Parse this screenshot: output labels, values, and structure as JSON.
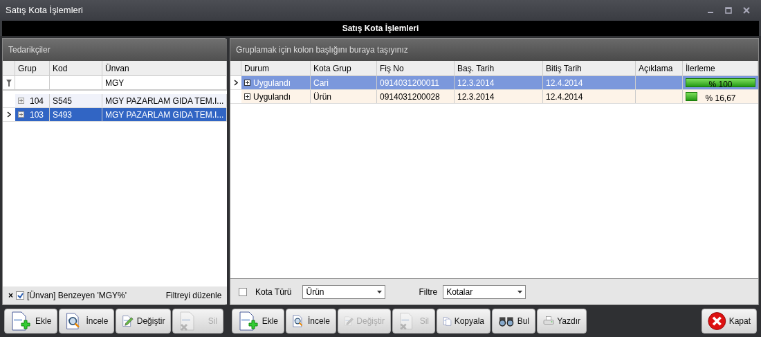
{
  "window": {
    "title": "Satış Kota İşlemleri"
  },
  "header": {
    "title": "Satış Kota İşlemleri"
  },
  "left": {
    "group_title": "Tedarikçiler",
    "columns": [
      "Grup",
      "Kod",
      "Ünvan"
    ],
    "filter_row": {
      "unvan": "MGY"
    },
    "rows": [
      {
        "cells": [
          "104",
          "S545",
          "MGY PAZARLAM GIDA TEM.I..."
        ],
        "selected": false
      },
      {
        "cells": [
          "103",
          "S493",
          "MGY PAZARLAM GIDA TEM.I..."
        ],
        "selected": true
      }
    ],
    "filter_bar": {
      "close": "×",
      "checked": true,
      "text": "[Ünvan] Benzeyen 'MGY%'",
      "edit": "Filtreyi düzenle"
    },
    "toolbar": [
      {
        "kind": "add",
        "label": "Ekle",
        "disabled": false
      },
      {
        "kind": "view",
        "label": "İncele",
        "disabled": false
      },
      {
        "kind": "edit",
        "label": "Değiştir",
        "disabled": false
      },
      {
        "kind": "delete",
        "label": "Sil",
        "disabled": true
      }
    ]
  },
  "right": {
    "group_hint": "Gruplamak için kolon başlığını buraya taşıyınız",
    "columns": [
      "Durum",
      "Kota Grup",
      "Fiş No",
      "Baş. Tarih",
      "Bitiş Tarih",
      "Açıklama",
      "İlerleme"
    ],
    "rows": [
      {
        "cells": [
          "Uygulandı",
          "Cari",
          "0914031200011",
          "12.3.2014",
          "12.4.2014"
        ],
        "progress": "% 100",
        "level": 1,
        "selected": true
      },
      {
        "cells": [
          "Uygulandı",
          "Ürün",
          "0914031200028",
          "12.3.2014",
          "12.4.2014"
        ],
        "progress": "% 16,67",
        "level": 0.1667,
        "selected": false
      }
    ],
    "options": {
      "kota_turu_label": "Kota Türü",
      "kota_turu_checked": false,
      "kota_turu_value": "Ürün",
      "filtre_label": "Filtre",
      "filtre_value": "Kotalar"
    },
    "toolbar": [
      {
        "kind": "add",
        "label": "Ekle",
        "disabled": false
      },
      {
        "kind": "view",
        "label": "İncele",
        "disabled": false
      },
      {
        "kind": "edit",
        "label": "Değiştir",
        "disabled": true
      },
      {
        "kind": "delete",
        "label": "Sil",
        "disabled": true
      },
      {
        "kind": "copy",
        "label": "Kopyala",
        "disabled": false
      },
      {
        "kind": "find",
        "label": "Bul",
        "disabled": false
      },
      {
        "kind": "print",
        "label": "Yazdır",
        "disabled": false
      }
    ],
    "close_button": {
      "kind": "close",
      "label": "Kapat",
      "disabled": false
    }
  }
}
